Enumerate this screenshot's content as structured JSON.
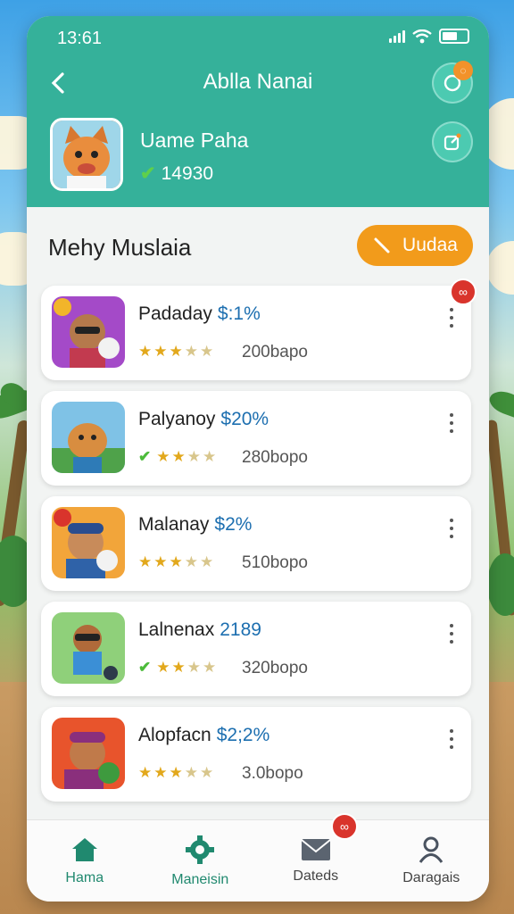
{
  "status": {
    "time": "13:61"
  },
  "header": {
    "title": "Ablla Nanai",
    "notification_badge": "◌"
  },
  "profile": {
    "name": "Uame Paha",
    "score": "14930"
  },
  "section": {
    "title": "Mehy Muslaia",
    "update_label": "Uudaa"
  },
  "items": [
    {
      "name": "Padaday",
      "percent": "$:1%",
      "rating": 3.5,
      "count": "200bapo",
      "verified": false,
      "badge": "∞"
    },
    {
      "name": "Palyanoy",
      "percent": "$20%",
      "rating": 3.5,
      "count": "280bopo",
      "verified": true
    },
    {
      "name": "Malanay",
      "percent": "$2%",
      "rating": 3.5,
      "count": "510bopo",
      "verified": false
    },
    {
      "name": "Lalnenax",
      "percent": "2189",
      "rating": 3.5,
      "count": "320bopo",
      "verified": true
    },
    {
      "name": "Alopfacn",
      "percent": "$2;2%",
      "rating": 3.5,
      "count": "3.0bopo",
      "verified": false
    }
  ],
  "nav": [
    {
      "label": "Hama",
      "icon": "home-icon",
      "active": true
    },
    {
      "label": "Maneisin",
      "icon": "gear-icon",
      "active": true
    },
    {
      "label": "Dateds",
      "icon": "mail-icon",
      "active": false,
      "badge": "∞"
    },
    {
      "label": "Daragais",
      "icon": "person-icon",
      "active": false
    }
  ],
  "colors": {
    "header": "#35b19a",
    "accent": "#f29b1b",
    "link": "#1d6fb0",
    "badge": "#d9342c"
  }
}
